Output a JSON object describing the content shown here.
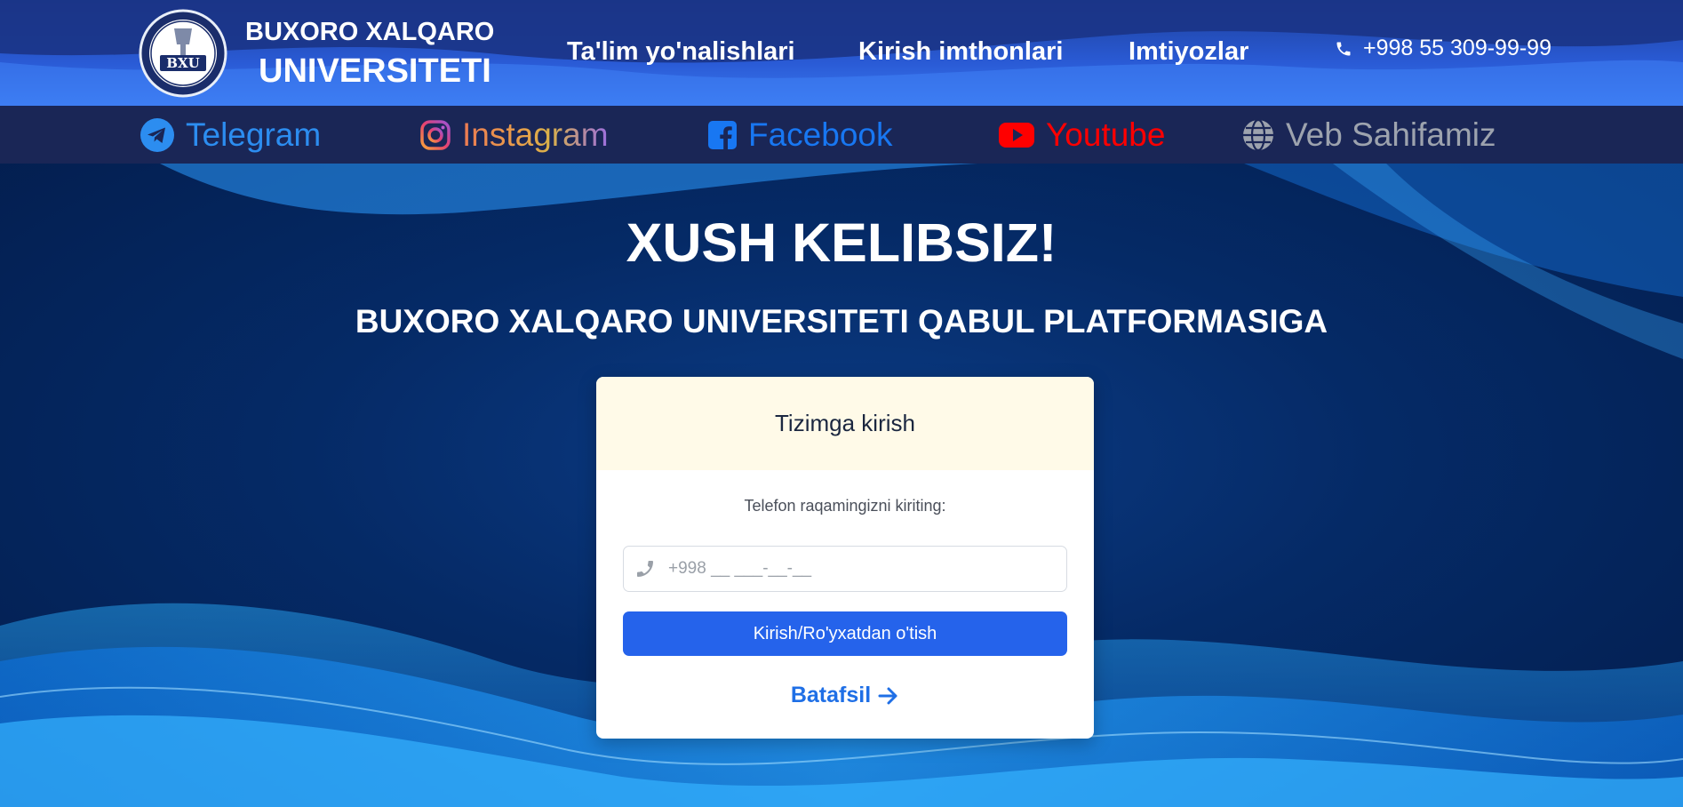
{
  "brand": {
    "line1": "BUXORO XALQARO",
    "line2": "UNIVERSITETI",
    "logo_text": "BXU"
  },
  "nav": {
    "items": [
      {
        "label": "Ta'lim yo'nalishlari"
      },
      {
        "label": "Kirish imthonlari"
      },
      {
        "label": "Imtiyozlar"
      }
    ],
    "phone": "+998 55 309-99-99"
  },
  "social": {
    "telegram": {
      "label": "Telegram",
      "icon": "telegram-icon",
      "color": "#2c8df0"
    },
    "instagram": {
      "label": "Instagram",
      "icon": "instagram-icon",
      "color": "#e8a04a"
    },
    "facebook": {
      "label": "Facebook",
      "icon": "facebook-icon",
      "color": "#1877f2"
    },
    "youtube": {
      "label": "Youtube",
      "icon": "youtube-icon",
      "color": "#ff0000"
    },
    "website": {
      "label": "Veb Sahifamiz",
      "icon": "globe-icon",
      "color": "#9da3ae"
    }
  },
  "hero": {
    "title": "XUSH KELIBSIZ!",
    "subtitle": "BUXORO XALQARO UNIVERSITETI QABUL PLATFORMASIGA"
  },
  "login": {
    "header": "Tizimga kirish",
    "label": "Telefon raqamingizni kiriting:",
    "phone_placeholder": "+998 __ ___-__-__",
    "phone_value": "",
    "submit_label": "Kirish/Ro'yxatdan o'tish",
    "more_label": "Batafsil"
  },
  "colors": {
    "accent": "#2563eb",
    "header_top": "#1d3f9a",
    "social_bar": "#1a2656",
    "card_header": "#fffae8"
  }
}
